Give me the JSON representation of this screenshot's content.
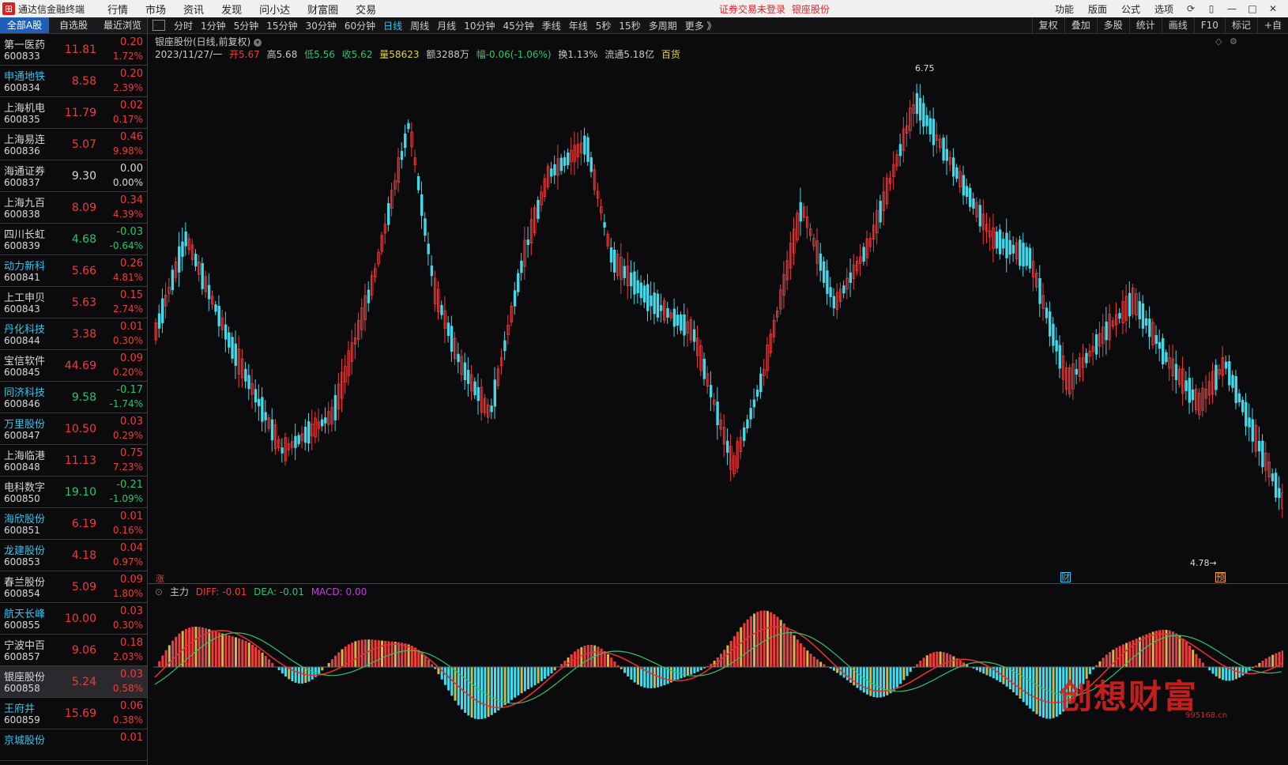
{
  "app": {
    "title": "通达信金融终端",
    "menu": [
      "行情",
      "市场",
      "资讯",
      "发现",
      "问小达",
      "财富圈",
      "交易"
    ],
    "warning": "证券交易未登录",
    "current_stock_tag": "银座股份",
    "right_menu": [
      "功能",
      "版面",
      "公式",
      "选项"
    ]
  },
  "left": {
    "tabs": [
      "全部A股",
      "自选股",
      "最近浏览"
    ],
    "stocks": [
      {
        "name": "第一医药",
        "code": "600833",
        "price": "11.81",
        "chg": "0.20",
        "pct": "1.72%",
        "dir": "up",
        "blue": false
      },
      {
        "name": "申通地铁",
        "code": "600834",
        "price": "8.58",
        "chg": "0.20",
        "pct": "2.39%",
        "dir": "up",
        "blue": true
      },
      {
        "name": "上海机电",
        "code": "600835",
        "price": "11.79",
        "chg": "0.02",
        "pct": "0.17%",
        "dir": "up",
        "blue": false
      },
      {
        "name": "上海易连",
        "code": "600836",
        "price": "5.07",
        "chg": "0.46",
        "pct": "9.98%",
        "dir": "up",
        "blue": false
      },
      {
        "name": "海通证券",
        "code": "600837",
        "price": "9.30",
        "chg": "0.00",
        "pct": "0.00%",
        "dir": "flat",
        "blue": false
      },
      {
        "name": "上海九百",
        "code": "600838",
        "price": "8.09",
        "chg": "0.34",
        "pct": "4.39%",
        "dir": "up",
        "blue": false
      },
      {
        "name": "四川长虹",
        "code": "600839",
        "price": "4.68",
        "chg": "-0.03",
        "pct": "-0.64%",
        "dir": "down",
        "blue": false
      },
      {
        "name": "动力新科",
        "code": "600841",
        "price": "5.66",
        "chg": "0.26",
        "pct": "4.81%",
        "dir": "up",
        "blue": true
      },
      {
        "name": "上工申贝",
        "code": "600843",
        "price": "5.63",
        "chg": "0.15",
        "pct": "2.74%",
        "dir": "up",
        "blue": false
      },
      {
        "name": "丹化科技",
        "code": "600844",
        "price": "3.38",
        "chg": "0.01",
        "pct": "0.30%",
        "dir": "up",
        "blue": true
      },
      {
        "name": "宝信软件",
        "code": "600845",
        "price": "44.69",
        "chg": "0.09",
        "pct": "0.20%",
        "dir": "up",
        "blue": false
      },
      {
        "name": "同济科技",
        "code": "600846",
        "price": "9.58",
        "chg": "-0.17",
        "pct": "-1.74%",
        "dir": "down",
        "blue": true
      },
      {
        "name": "万里股份",
        "code": "600847",
        "price": "10.50",
        "chg": "0.03",
        "pct": "0.29%",
        "dir": "up",
        "blue": true
      },
      {
        "name": "上海临港",
        "code": "600848",
        "price": "11.13",
        "chg": "0.75",
        "pct": "7.23%",
        "dir": "up",
        "blue": false
      },
      {
        "name": "电科数字",
        "code": "600850",
        "price": "19.10",
        "chg": "-0.21",
        "pct": "-1.09%",
        "dir": "down",
        "blue": false
      },
      {
        "name": "海欣股份",
        "code": "600851",
        "price": "6.19",
        "chg": "0.01",
        "pct": "0.16%",
        "dir": "up",
        "blue": true
      },
      {
        "name": "龙建股份",
        "code": "600853",
        "price": "4.18",
        "chg": "0.04",
        "pct": "0.97%",
        "dir": "up",
        "blue": true
      },
      {
        "name": "春兰股份",
        "code": "600854",
        "price": "5.09",
        "chg": "0.09",
        "pct": "1.80%",
        "dir": "up",
        "blue": false
      },
      {
        "name": "航天长峰",
        "code": "600855",
        "price": "10.00",
        "chg": "0.03",
        "pct": "0.30%",
        "dir": "up",
        "blue": true
      },
      {
        "name": "宁波中百",
        "code": "600857",
        "price": "9.06",
        "chg": "0.18",
        "pct": "2.03%",
        "dir": "up",
        "blue": false
      },
      {
        "name": "银座股份",
        "code": "600858",
        "price": "5.24",
        "chg": "0.03",
        "pct": "0.58%",
        "dir": "up",
        "blue": false,
        "selected": true
      },
      {
        "name": "王府井",
        "code": "600859",
        "price": "15.69",
        "chg": "0.06",
        "pct": "0.38%",
        "dir": "up",
        "blue": true
      },
      {
        "name": "京城股份",
        "code": "",
        "price": "",
        "chg": "0.01",
        "pct": "",
        "dir": "up",
        "blue": true
      }
    ]
  },
  "periods": [
    "分时",
    "1分钟",
    "5分钟",
    "15分钟",
    "30分钟",
    "60分钟",
    "日线",
    "周线",
    "月线",
    "10分钟",
    "45分钟",
    "季线",
    "年线",
    "5秒",
    "15秒",
    "多周期",
    "更多 》"
  ],
  "active_period": "日线",
  "tools": [
    "复权",
    "叠加",
    "多股",
    "统计",
    "画线",
    "F10",
    "标记",
    "+自"
  ],
  "chart": {
    "title": "银座股份(日线,前复权)",
    "date": "2023/11/27/一",
    "open": "开5.67",
    "high": "高5.68",
    "low": "低5.56",
    "close": "收5.62",
    "vol": "量58623",
    "amount": "额3288万",
    "range": "幅-0.06(-1.06%)",
    "turnover": "换1.13%",
    "float": "流通5.18亿",
    "sector": "百货",
    "max_label": "6.75",
    "min_label": "4.78→",
    "mark_left": "涨",
    "mark_cai": "财",
    "mark_yu": "预"
  },
  "macd": {
    "indicator": "主力",
    "diff": "DIFF: -0.01",
    "dea": "DEA: -0.01",
    "macd": "MACD: 0.00"
  },
  "watermark": {
    "text": "创想财富",
    "url": "995168.cn"
  },
  "colors": {
    "up": "#f03c3c",
    "down": "#44d8e8",
    "accent": "#2fc6f0",
    "diff": "#e23030",
    "dea": "#2ec46a"
  }
}
